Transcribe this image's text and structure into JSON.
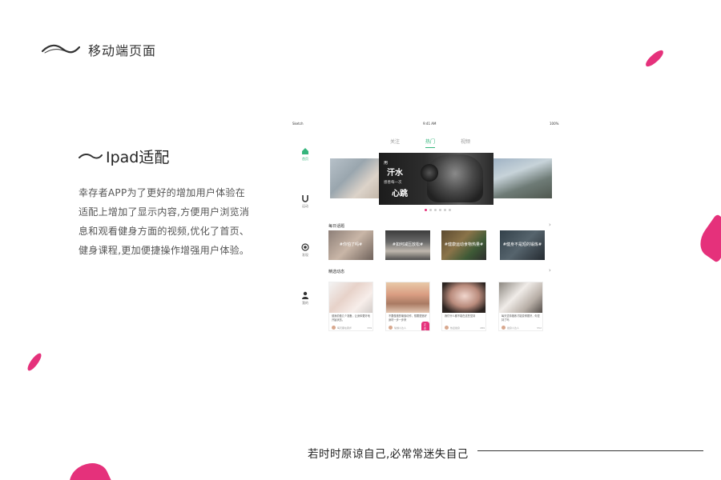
{
  "page": {
    "title": "移动端页面",
    "accent_color": "#e5317b"
  },
  "section": {
    "title": "Ipad适配",
    "description": "幸存者APP为了更好的增加用户体验在适配上增加了显示内容,方便用户浏览消息和观看健身方面的视频,优化了首页、健身课程,更加便捷操作增强用户体验。"
  },
  "ipad": {
    "status": {
      "carrier": "Sketch",
      "time": "9:41 AM",
      "battery": "100%"
    },
    "sidebar": [
      {
        "label": "首页",
        "icon": "home-icon",
        "active": true
      },
      {
        "label": "运动",
        "icon": "magnet-icon",
        "active": false
      },
      {
        "label": "发现",
        "icon": "discover-icon",
        "active": false
      },
      {
        "label": "我的",
        "icon": "person-icon",
        "active": false
      }
    ],
    "tabs": [
      {
        "label": "关注",
        "active": false
      },
      {
        "label": "热门",
        "active": true
      },
      {
        "label": "视频",
        "active": false
      }
    ],
    "banner": {
      "line1": "用",
      "line2": "汗水",
      "line3": "感善每一次",
      "line4": "心跳"
    },
    "daily_topics": {
      "title": "每日话题",
      "items": [
        {
          "caption": "#你怕了吗#"
        },
        {
          "caption": "#如何减压放松#"
        },
        {
          "caption": "#健康运动食物热量#"
        },
        {
          "caption": "#健身不是短的锻炼#"
        }
      ]
    },
    "featured": {
      "title": "精选动态",
      "live_badge": "正在直播",
      "posts": [
        {
          "text": "健身前做几个准备，让身体更好地开始状态。",
          "user": "每天都在跑步",
          "likes": "339"
        },
        {
          "text": "不要做错的瑜伽动作，想要塑造好身材一步一步来",
          "user": "瑜伽小达人",
          "likes": "95"
        },
        {
          "text": "我们什么都不能在这些坚持",
          "user": "热爱健身",
          "likes": "289"
        },
        {
          "text": "每天坚持锻炼才能变得更好，你坚持了吗",
          "user": "健身小达人",
          "likes": "552"
        }
      ]
    }
  },
  "footer": {
    "quote": "若时时原谅自己,必常常迷失自己"
  }
}
